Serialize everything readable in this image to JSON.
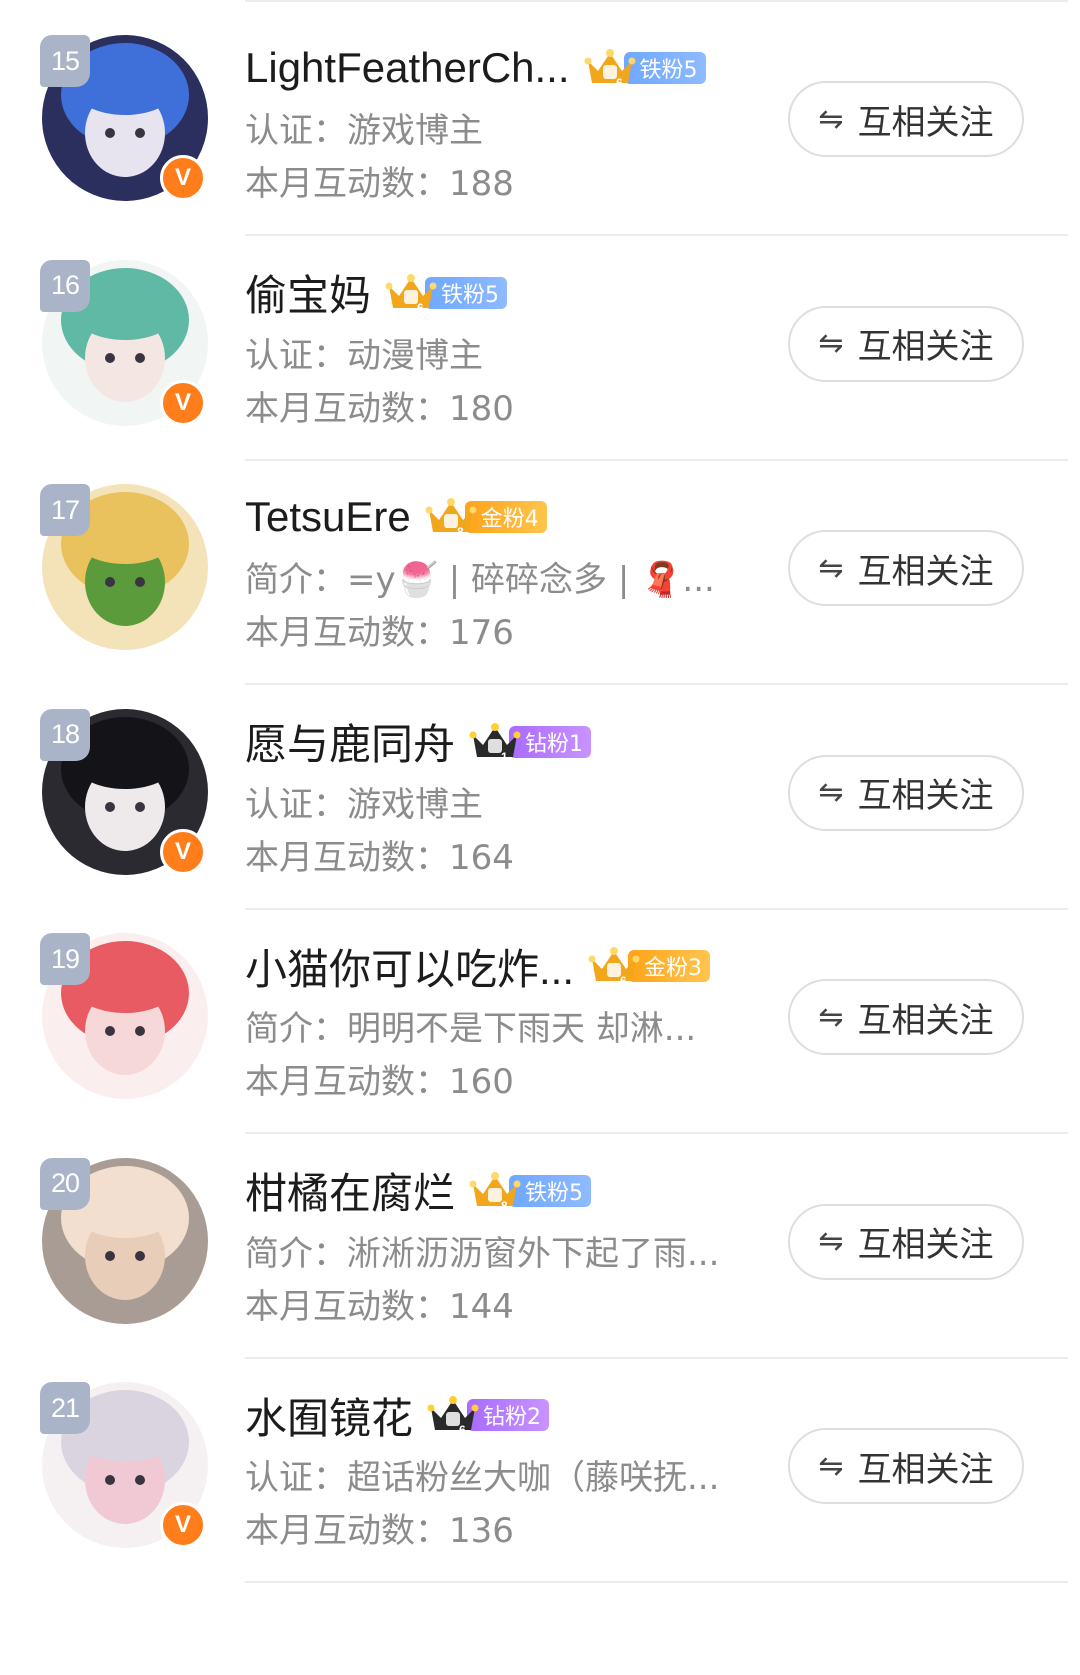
{
  "list": [
    {
      "rank": "15",
      "name": "LightFeatherCh...",
      "badge": {
        "type": "iron",
        "label": "铁粉5",
        "crown_level": "6"
      },
      "verified": true,
      "desc": "认证：游戏博主",
      "stat_label": "本月互动数：",
      "stat_value": "188",
      "button_label": "互相关注",
      "avatar_colors": [
        "#2b2f5e",
        "#3f6fd8",
        "#e7e3ef"
      ]
    },
    {
      "rank": "16",
      "name": "偷宝妈",
      "badge": {
        "type": "iron",
        "label": "铁粉5",
        "crown_level": "6"
      },
      "verified": true,
      "desc": "认证：动漫博主",
      "stat_label": "本月互动数：",
      "stat_value": "180",
      "button_label": "互相关注",
      "avatar_colors": [
        "#f1f5f4",
        "#5fb9a5",
        "#f4e6e3"
      ]
    },
    {
      "rank": "17",
      "name": "TetsuEre",
      "badge": {
        "type": "gold",
        "label": "金粉4",
        "crown_level": "8"
      },
      "verified": false,
      "desc": "简介：=y🍧 | 碎碎念多 | 🧣...",
      "stat_label": "本月互动数：",
      "stat_value": "176",
      "button_label": "互相关注",
      "avatar_colors": [
        "#f4e3b8",
        "#e9c15d",
        "#5b9b3c"
      ]
    },
    {
      "rank": "18",
      "name": "愿与鹿同舟",
      "badge": {
        "type": "diamond",
        "label": "钻粉1",
        "crown_level": "1"
      },
      "verified": true,
      "desc": "认证：游戏博主",
      "stat_label": "本月互动数：",
      "stat_value": "164",
      "button_label": "互相关注",
      "avatar_colors": [
        "#2a2a30",
        "#141418",
        "#eee9ea"
      ]
    },
    {
      "rank": "19",
      "name": "小猫你可以吃炸...",
      "badge": {
        "type": "gold",
        "label": "金粉3",
        "crown_level": "6"
      },
      "verified": false,
      "desc": "简介：明明不是下雨天 却淋...",
      "stat_label": "本月互动数：",
      "stat_value": "160",
      "button_label": "互相关注",
      "avatar_colors": [
        "#fbeeee",
        "#e85b62",
        "#f7d8d8"
      ]
    },
    {
      "rank": "20",
      "name": "柑橘在腐烂",
      "badge": {
        "type": "iron",
        "label": "铁粉5",
        "crown_level": "8"
      },
      "verified": false,
      "desc": "简介：淅淅沥沥窗外下起了雨...",
      "stat_label": "本月互动数：",
      "stat_value": "144",
      "button_label": "互相关注",
      "avatar_colors": [
        "#a99c94",
        "#f2dfcf",
        "#e8cdb8"
      ]
    },
    {
      "rank": "21",
      "name": "水囿镜花",
      "badge": {
        "type": "diamond",
        "label": "钻粉2",
        "crown_level": "6"
      },
      "verified": true,
      "desc": "认证：超话粉丝大咖（藤咲抚...",
      "stat_label": "本月互动数：",
      "stat_value": "136",
      "button_label": "互相关注",
      "avatar_colors": [
        "#f5f1f3",
        "#d9d4df",
        "#f0c9d4"
      ]
    }
  ],
  "colors": {
    "verified_badge": "#ff7d1a",
    "rank_badge": "#a9b4c8",
    "iron_badge": "#6ea8ff",
    "gold_badge": "#ffa31a",
    "diamond_badge": "#a86bff"
  },
  "icons": {
    "follow_button_icon": "swap-arrows-icon",
    "verified_icon": "verified-v-icon",
    "fan_badge_icon": "crown-icon"
  }
}
